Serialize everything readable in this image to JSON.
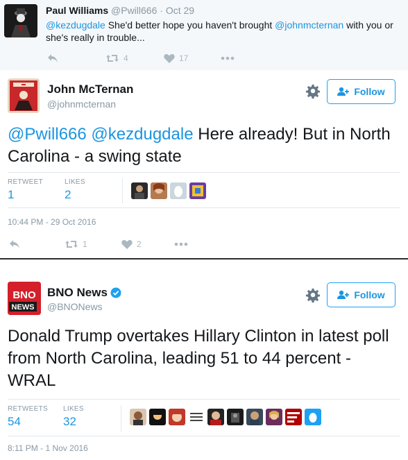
{
  "reply": {
    "name": "Paul Williams",
    "handle": "@Pwill666",
    "separator": "·",
    "time": "Oct 29",
    "mention1": "@kezdugdale",
    "text1": " She'd better hope you haven't brought ",
    "mention2": "@johnmcternan",
    "text2": " with you or she's really in trouble...",
    "retweet_count": "4",
    "like_count": "17"
  },
  "tweet1": {
    "name": "John McTernan",
    "handle": "@johnmcternan",
    "follow_label": "Follow",
    "mention1": "@Pwill666",
    "mention2": "@kezdugdale",
    "text": " Here already! But in North Carolina - a swing state",
    "retweets_label": "RETWEET",
    "retweets": "1",
    "likes_label": "LIKES",
    "likes": "2",
    "timestamp": "10:44 PM - 29 Oct 2016",
    "action_retweets": "1",
    "action_likes": "2"
  },
  "tweet2": {
    "name": "BNO News",
    "handle": "@BNONews",
    "follow_label": "Follow",
    "avatar_line1": "BNO",
    "avatar_line2": "NEWS",
    "text": "Donald Trump overtakes Hillary Clinton in latest poll from North Carolina, leading 51 to 44 percent - WRAL",
    "retweets_label": "RETWEETS",
    "retweets": "54",
    "likes_label": "LIKES",
    "likes": "32",
    "timestamp": "8:11 PM - 1 Nov 2016"
  },
  "colors": {
    "link": "#1b95e0",
    "muted": "#8899a6",
    "action_gray": "#aab8c2",
    "reply_bg": "#f5f8fa",
    "verified": "#1da1f2",
    "bno_red": "#d3202a"
  },
  "icons": [
    "reply-icon",
    "retweet-icon",
    "like-icon",
    "more-icon",
    "gear-icon",
    "follow-person-icon",
    "verified-badge-icon"
  ]
}
